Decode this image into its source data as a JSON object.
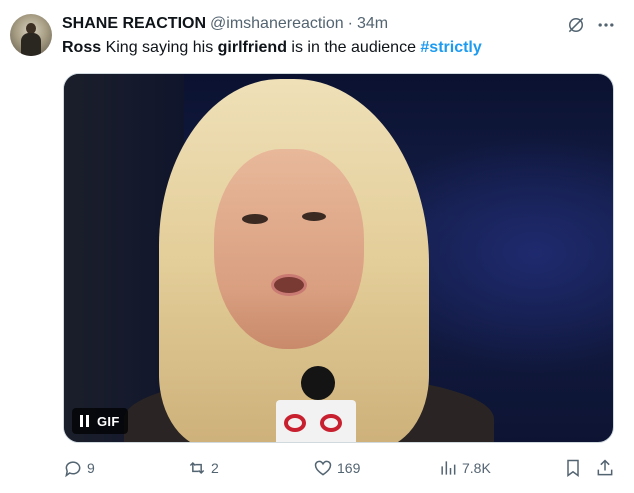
{
  "tweet": {
    "author_name": "SHANE REACTION",
    "handle": "@imshanereaction",
    "separator": "·",
    "time": "34m",
    "text": {
      "part1": "Ross",
      "part2": " King saying his ",
      "part3": "girlfriend",
      "part4": " is in the audience ",
      "hashtag": "#strictly"
    },
    "media": {
      "badge_label": "GIF"
    },
    "actions": {
      "replies": "9",
      "retweets": "2",
      "likes": "169",
      "views": "7.8K"
    }
  },
  "colors": {
    "accent": "#1d9bf0",
    "secondary_text": "#536471",
    "primary_text": "#0f1419"
  },
  "icons": [
    "grok-icon",
    "more-icon",
    "reply-icon",
    "retweet-icon",
    "like-icon",
    "views-icon",
    "bookmark-icon",
    "share-icon",
    "pause-icon"
  ]
}
